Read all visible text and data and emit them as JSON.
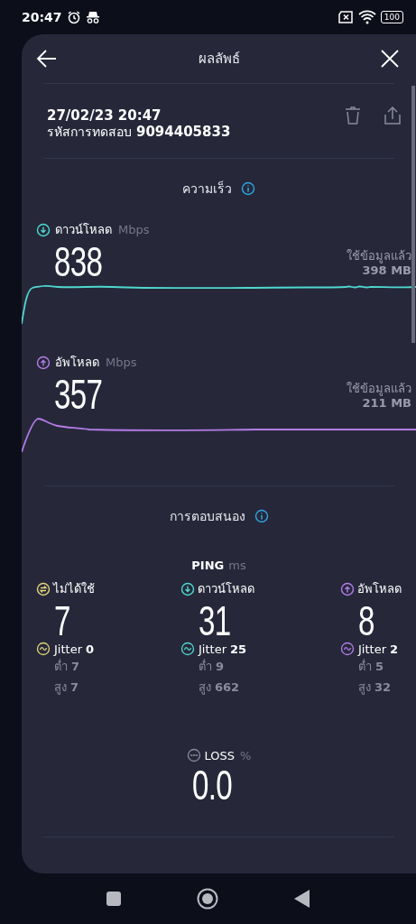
{
  "status_bar": {
    "time": "20:47",
    "battery": "100"
  },
  "header": {
    "title": "ผลลัพธ์"
  },
  "result": {
    "datetime": "27/02/23 20:47",
    "test_id_label": "รหัสการทดสอบ",
    "test_id": "9094405833"
  },
  "speed": {
    "heading": "ความเร็ว",
    "metrics": [
      {
        "kind": "download",
        "label": "ดาวน์โหลด",
        "unit": "Mbps",
        "value": "838",
        "used_label": "ใช้ข้อมูลแล้ว",
        "used": "398 MB",
        "color": "#4fd8d0"
      },
      {
        "kind": "upload",
        "label": "อัพโหลด",
        "unit": "Mbps",
        "value": "357",
        "used_label": "ใช้ข้อมูลแล้ว",
        "used": "211 MB",
        "color": "#b57ce8"
      }
    ]
  },
  "responsiveness": {
    "heading": "การตอบสนอง",
    "ping_label": "PING",
    "ping_unit": "ms",
    "columns": [
      {
        "kind": "idle",
        "label": "ไม่ได้ใช้",
        "value": "7",
        "jitter_label": "Jitter",
        "jitter": "0",
        "low_label": "ต่ำ",
        "low": "7",
        "high_label": "สูง",
        "high": "7",
        "color": "#e3d47a"
      },
      {
        "kind": "download",
        "label": "ดาวน์โหลด",
        "value": "31",
        "jitter_label": "Jitter",
        "jitter": "25",
        "low_label": "ต่ำ",
        "low": "9",
        "high_label": "สูง",
        "high": "662",
        "color": "#4fd8d0"
      },
      {
        "kind": "upload",
        "label": "อัพโหลด",
        "value": "8",
        "jitter_label": "Jitter",
        "jitter": "2",
        "low_label": "ต่ำ",
        "low": "5",
        "high_label": "สูง",
        "high": "32",
        "color": "#b57ce8"
      }
    ]
  },
  "loss": {
    "label": "LOSS",
    "unit": "%",
    "value": "0.0"
  }
}
